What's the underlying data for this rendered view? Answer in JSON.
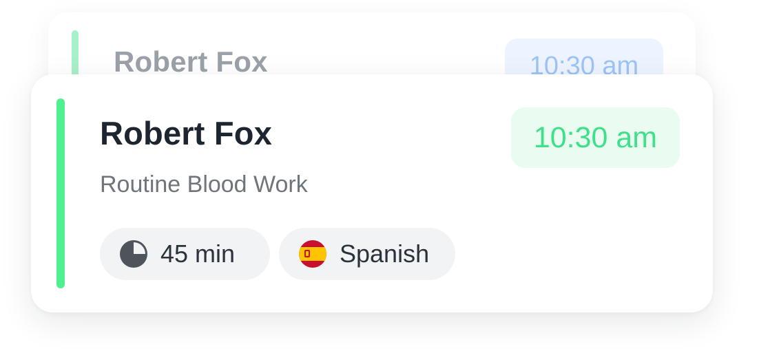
{
  "background_card": {
    "name": "Robert Fox",
    "time": "10:30 am"
  },
  "appointment": {
    "name": "Robert Fox",
    "description": "Routine Blood Work",
    "time": "10:30 am",
    "duration": "45 min",
    "duration_icon": "clock-pie-icon",
    "language": "Spanish",
    "language_icon": "spain-flag-icon"
  },
  "colors": {
    "accent_green": "#4ff08f",
    "time_text_green": "#3fe08a",
    "time_badge_bg": "#eafcf1",
    "back_time_text_blue": "#9cc4f4",
    "back_time_badge_bg": "#eef4ff",
    "pill_bg": "#f1f3f5"
  }
}
